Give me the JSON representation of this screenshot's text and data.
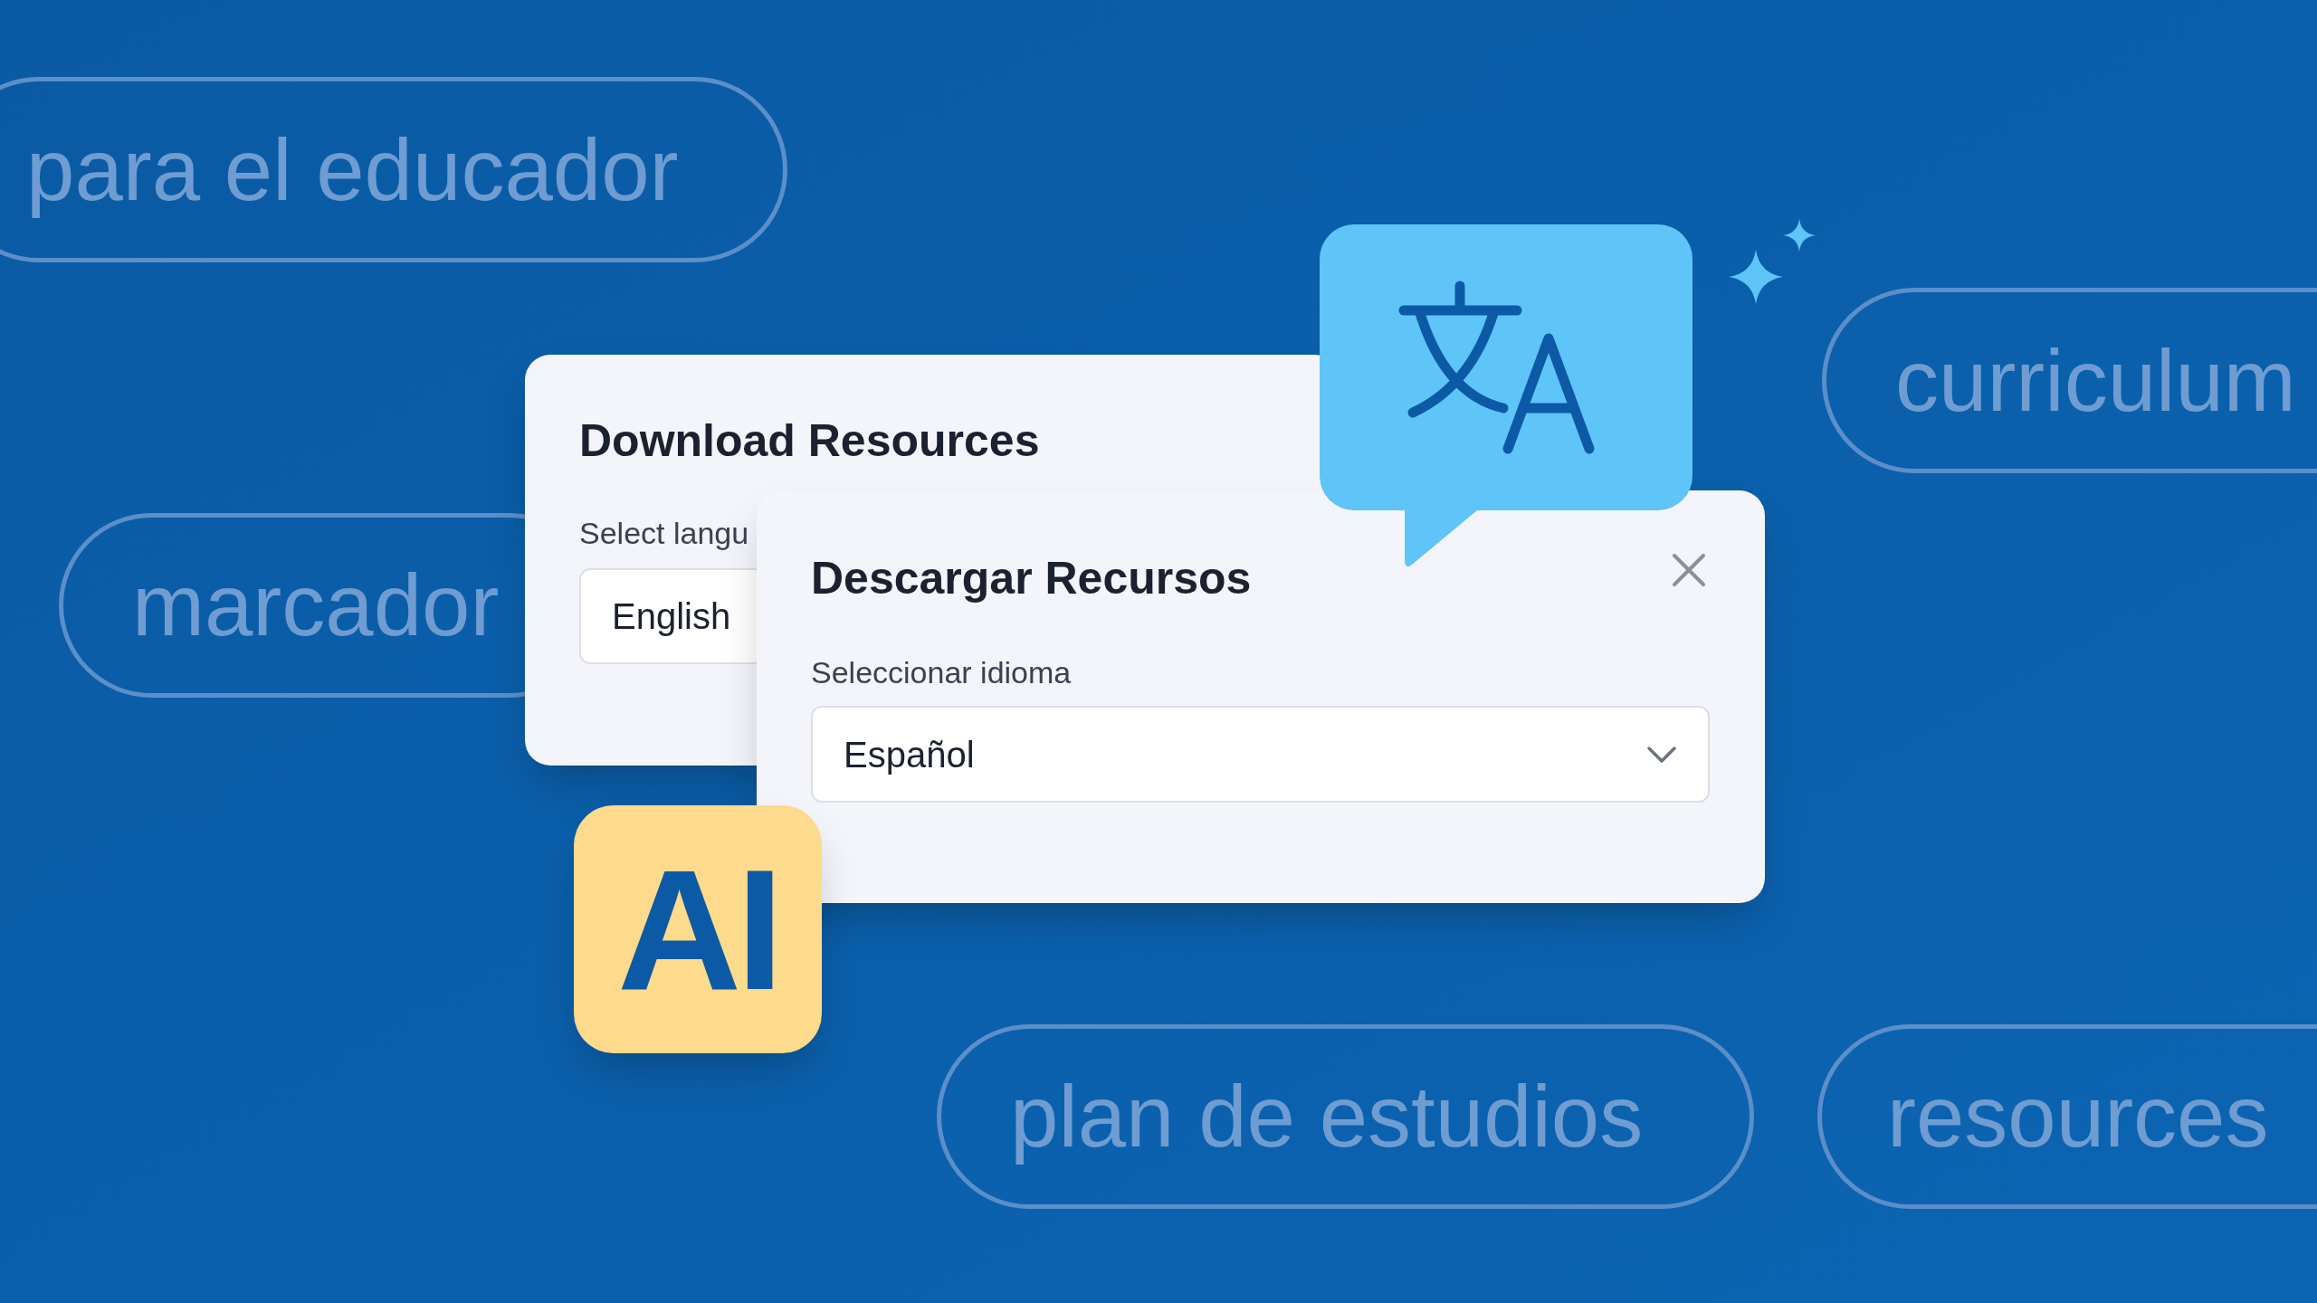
{
  "background_tags": [
    {
      "text": "para el educador"
    },
    {
      "text": "marcador"
    },
    {
      "text": "curriculum"
    },
    {
      "text": "plan de estudios"
    },
    {
      "text": "resources"
    }
  ],
  "back_dialog": {
    "title": "Download Resources",
    "label": "Select langu",
    "value": "English"
  },
  "front_dialog": {
    "title": "Descargar Recursos",
    "label": "Seleccionar idioma",
    "value": "Español"
  },
  "ai_badge": {
    "text": "AI"
  }
}
